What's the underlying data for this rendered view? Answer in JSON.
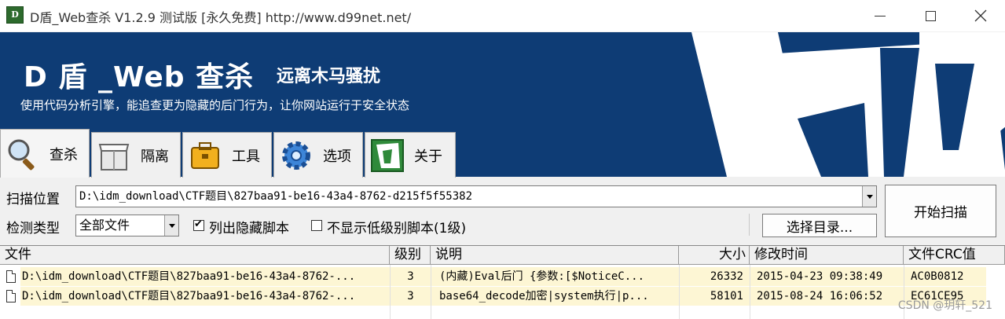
{
  "window": {
    "title": "D盾_Web查杀 V1.2.9 测试版 [永久免费] http://www.d99net.net/",
    "icon_text": "D"
  },
  "banner": {
    "title": "D 盾 _Web 查杀",
    "subtitle": "远离木马骚扰",
    "description": "使用代码分析引擎，能追查更为隐藏的后门行为，让你网站运行于安全状态"
  },
  "tabs": [
    {
      "label": "查杀",
      "icon": "magnifier-icon"
    },
    {
      "label": "隔离",
      "icon": "box-icon"
    },
    {
      "label": "工具",
      "icon": "briefcase-icon"
    },
    {
      "label": "选项",
      "icon": "gear-icon"
    },
    {
      "label": "关于",
      "icon": "d-logo-icon"
    }
  ],
  "scan": {
    "path_label": "扫描位置",
    "path_value": "D:\\idm_download\\CTF题目\\827baa91-be16-43a4-8762-d215f5f55382",
    "type_label": "检测类型",
    "type_value": "全部文件",
    "list_hidden_label": "列出隐藏脚本",
    "list_hidden_checked": true,
    "hide_low_label": "不显示低级别脚本(1级)",
    "hide_low_checked": false,
    "select_dir_label": "选择目录...",
    "start_label": "开始扫描"
  },
  "table": {
    "columns": [
      "文件",
      "级别",
      "说明",
      "大小",
      "修改时间",
      "文件CRC值"
    ],
    "rows": [
      {
        "file": "D:\\idm_download\\CTF题目\\827baa91-be16-43a4-8762-...",
        "level": "3",
        "desc": "(内藏)Eval后门 {参数:[$NoticeC...",
        "size": "26332",
        "mtime": "2015-04-23 09:38:49",
        "crc": "AC0B0812"
      },
      {
        "file": "D:\\idm_download\\CTF题目\\827baa91-be16-43a4-8762-...",
        "level": "3",
        "desc": "base64_decode加密|system执行|p...",
        "size": "58101",
        "mtime": "2015-08-24 16:06:52",
        "crc": "EC61CE95"
      }
    ]
  },
  "watermark": "CSDN @玥轩_521"
}
